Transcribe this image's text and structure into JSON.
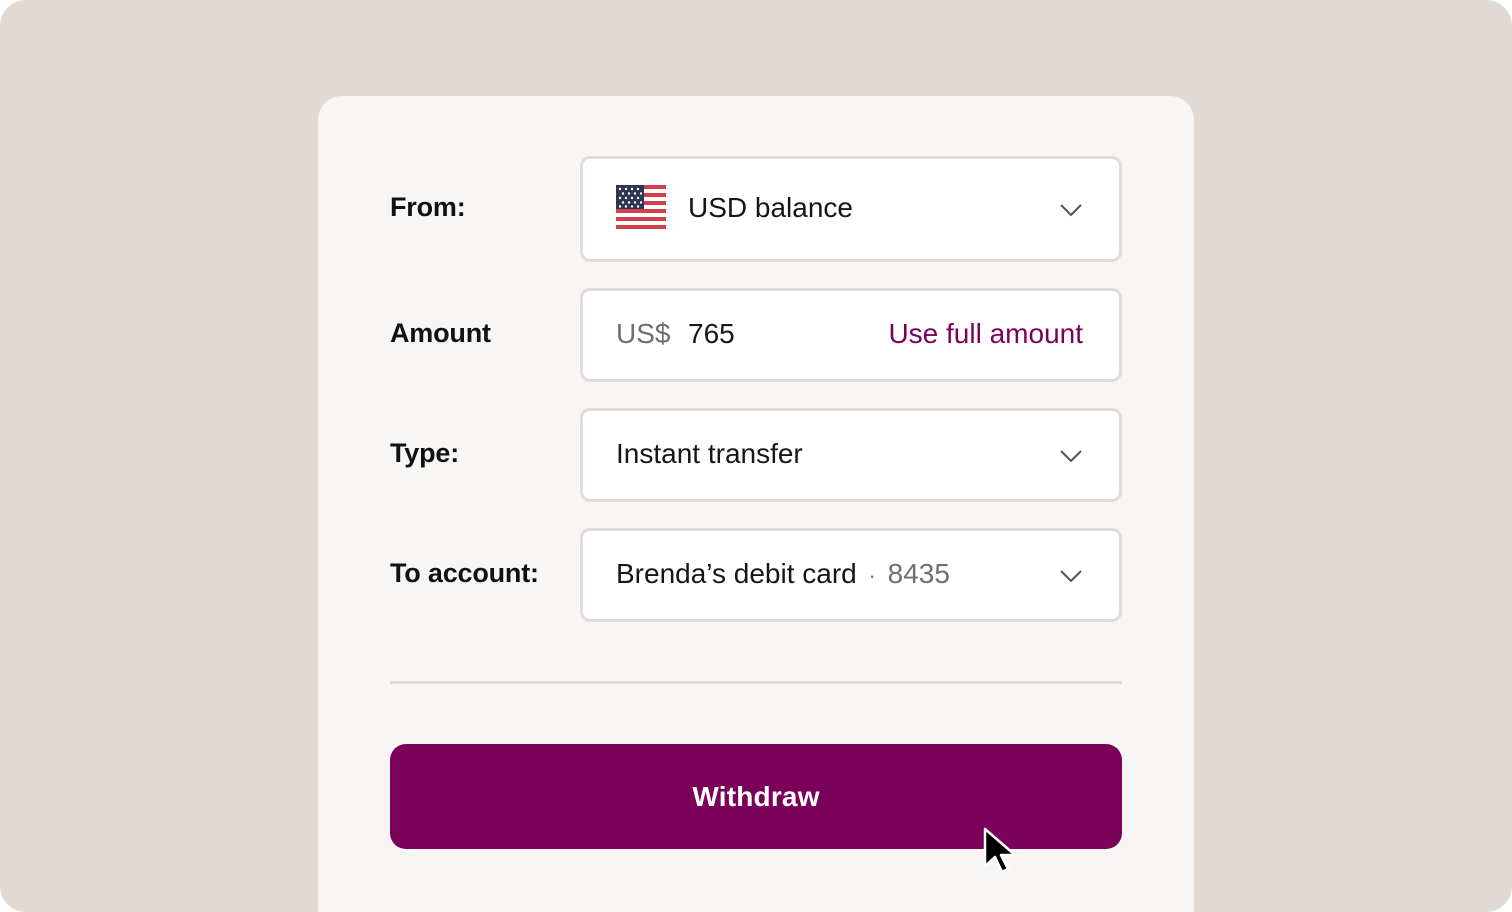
{
  "form": {
    "from": {
      "label": "From:",
      "flag_icon": "us-flag-icon",
      "value": "USD balance"
    },
    "amount": {
      "label": "Amount",
      "currency_prefix": "US$",
      "value": "765",
      "action_label": "Use full amount"
    },
    "type": {
      "label": "Type:",
      "value": "Instant transfer"
    },
    "to_account": {
      "label": "To account:",
      "name": "Brenda’s debit card",
      "separator": "·",
      "last4": "8435"
    },
    "submit_label": "Withdraw"
  },
  "colors": {
    "background": "#e1d9d4",
    "card": "#f7f6f5",
    "accent": "#7a0059",
    "field_border": "#e3dbd7"
  }
}
